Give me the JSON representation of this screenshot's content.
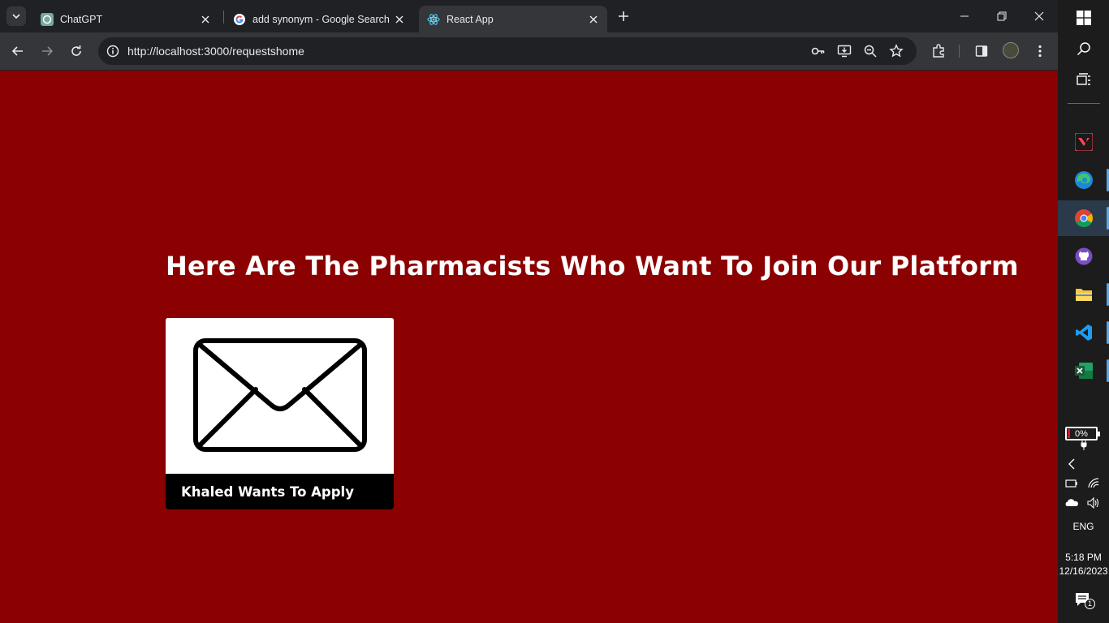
{
  "tabs": [
    {
      "title": "ChatGPT",
      "icon": "chatgpt-icon"
    },
    {
      "title": "add synonym - Google Search",
      "icon": "google-icon"
    },
    {
      "title": "React App",
      "icon": "react-icon",
      "active": true
    }
  ],
  "toolbar": {
    "url": "http://localhost:3000/requestshome"
  },
  "page": {
    "heading": "Here Are The Pharmacists Who Want To Join Our Platform",
    "background_color": "#8b0000",
    "requests": [
      {
        "label": "Khaled Wants To Apply",
        "icon": "envelope-icon"
      }
    ]
  },
  "taskbar": {
    "apps": [
      "valorant-icon",
      "edge-icon",
      "chrome-icon",
      "github-desktop-icon",
      "file-explorer-icon",
      "vscode-icon",
      "excel-icon"
    ],
    "battery": "0%",
    "language": "ENG",
    "time": "5:18 PM",
    "date": "12/16/2023",
    "notifications": "1"
  }
}
